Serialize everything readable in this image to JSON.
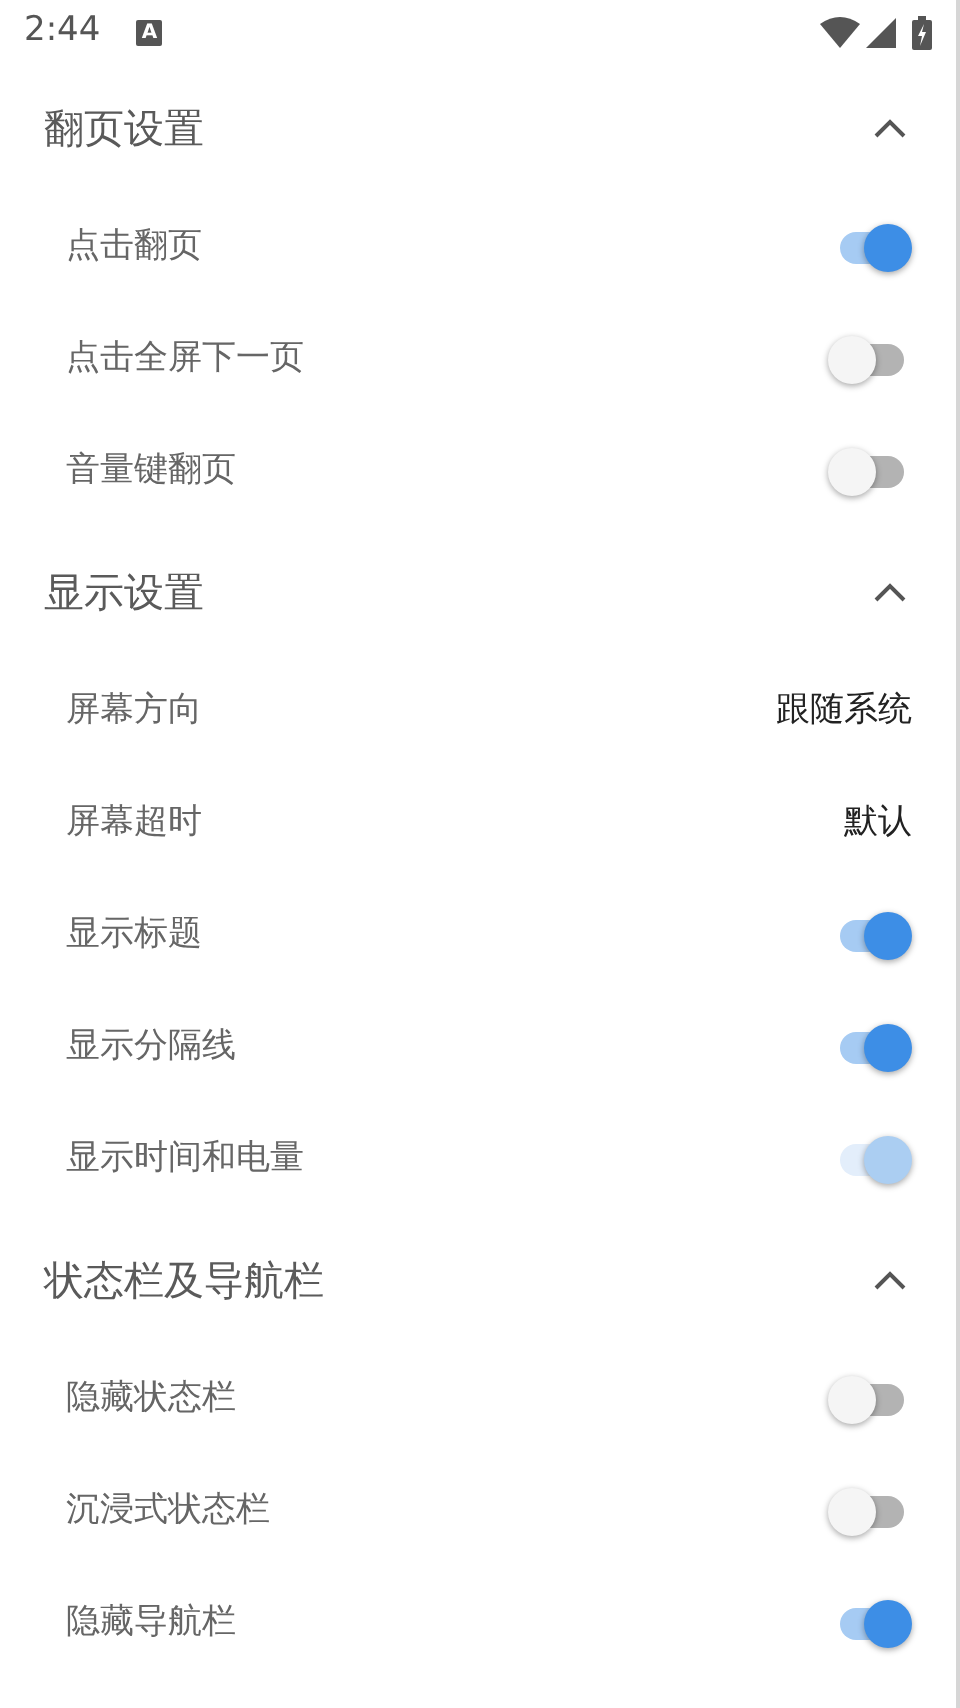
{
  "status_bar": {
    "time": "2:44",
    "notification": "A"
  },
  "sections": [
    {
      "title": "翻页设置",
      "expanded": true,
      "items": [
        {
          "kind": "switch",
          "label": "点击翻页",
          "on": true,
          "disabled": false
        },
        {
          "kind": "switch",
          "label": "点击全屏下一页",
          "on": false,
          "disabled": false
        },
        {
          "kind": "switch",
          "label": "音量键翻页",
          "on": false,
          "disabled": false
        }
      ]
    },
    {
      "title": "显示设置",
      "expanded": true,
      "items": [
        {
          "kind": "value",
          "label": "屏幕方向",
          "value": "跟随系统"
        },
        {
          "kind": "value",
          "label": "屏幕超时",
          "value": "默认"
        },
        {
          "kind": "switch",
          "label": "显示标题",
          "on": true,
          "disabled": false
        },
        {
          "kind": "switch",
          "label": "显示分隔线",
          "on": true,
          "disabled": false
        },
        {
          "kind": "switch",
          "label": "显示时间和电量",
          "on": true,
          "disabled": true
        }
      ]
    },
    {
      "title": "状态栏及导航栏",
      "expanded": true,
      "items": [
        {
          "kind": "switch",
          "label": "隐藏状态栏",
          "on": false,
          "disabled": false
        },
        {
          "kind": "switch",
          "label": "沉浸式状态栏",
          "on": false,
          "disabled": false
        },
        {
          "kind": "switch",
          "label": "隐藏导航栏",
          "on": true,
          "disabled": false
        }
      ]
    }
  ]
}
